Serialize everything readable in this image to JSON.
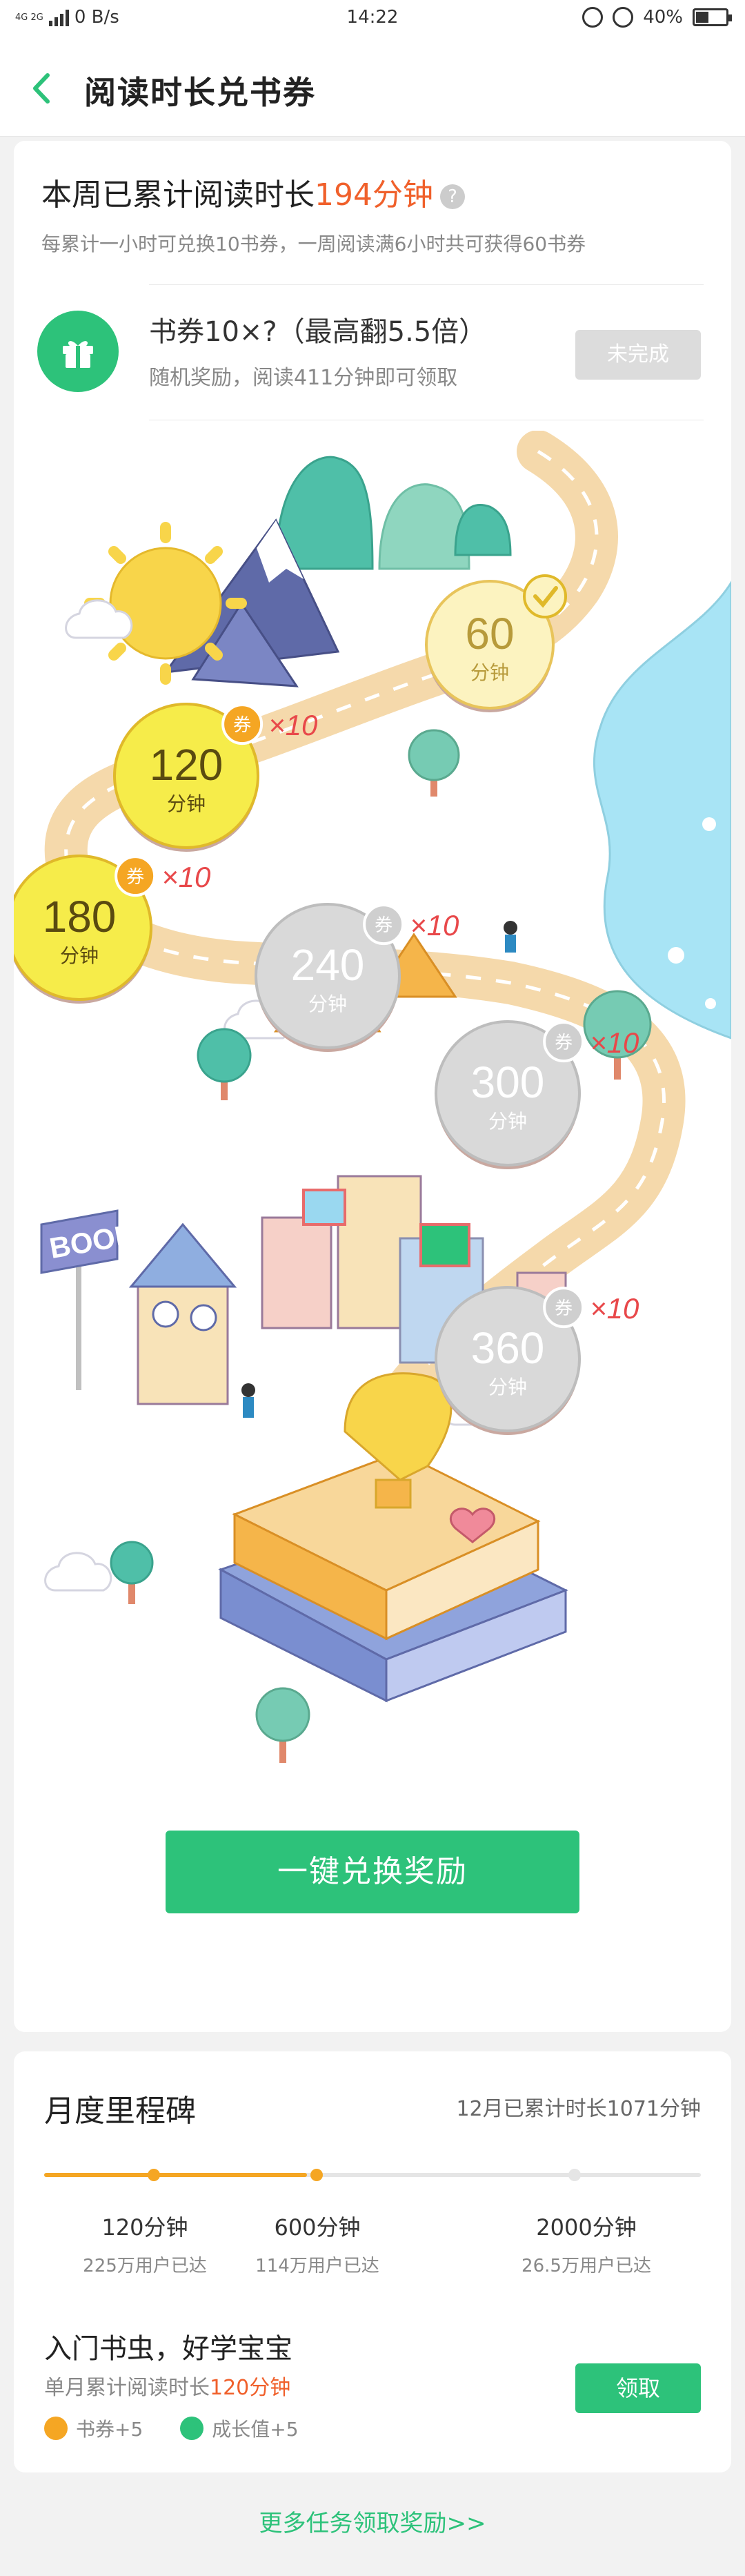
{
  "status_bar": {
    "network": "4G 2G",
    "speed": "0 B/s",
    "time": "14:22",
    "battery": "40%"
  },
  "header": {
    "title": "阅读时长兑书券"
  },
  "weekly": {
    "title_prefix": "本周已累计阅读时长",
    "minutes": "194分钟",
    "help": "?",
    "desc": "每累计一小时可兑换10书券，一周阅读满6小时共可获得60书券"
  },
  "voucher": {
    "title": "书券10×?（最高翻5.5倍）",
    "desc": "随机奖励，阅读411分钟即可领取",
    "status_button": "未完成"
  },
  "milestones": [
    {
      "value": "60",
      "unit": "分钟",
      "state": "done"
    },
    {
      "value": "120",
      "unit": "分钟",
      "state": "available",
      "reward": "×10",
      "badge": "券"
    },
    {
      "value": "180",
      "unit": "分钟",
      "state": "available",
      "reward": "×10",
      "badge": "券"
    },
    {
      "value": "240",
      "unit": "分钟",
      "state": "locked",
      "reward": "×10",
      "badge": "券"
    },
    {
      "value": "300",
      "unit": "分钟",
      "state": "locked",
      "reward": "×10",
      "badge": "券"
    },
    {
      "value": "360",
      "unit": "分钟",
      "state": "locked",
      "reward": "×10",
      "badge": "券"
    }
  ],
  "map_sign": "BOOK",
  "redeem_button": "一键兑换奖励",
  "monthly": {
    "title": "月度里程碑",
    "total": "12月已累计时长1071分钟",
    "progress": 0.4,
    "milestones": [
      {
        "value": "120分钟",
        "users": "225万用户已达"
      },
      {
        "value": "600分钟",
        "users": "114万用户已达"
      },
      {
        "value": "2000分钟",
        "users": "26.5万用户已达"
      }
    ],
    "badge_title": "入门书虫，好学宝宝",
    "badge_desc_prefix": "单月累计阅读时长",
    "badge_desc_minutes": "120分钟",
    "reward_voucher": "书券+5",
    "reward_growth": "成长值+5",
    "claim_button": "领取"
  },
  "more_link": "更多任务领取奖励>>",
  "colors": {
    "accent_green": "#2dc27a",
    "highlight_orange": "#f0602b",
    "progress_orange": "#f5a623",
    "coin_yellow": "#f6ec4a",
    "coin_grey": "#d9d9d9"
  }
}
